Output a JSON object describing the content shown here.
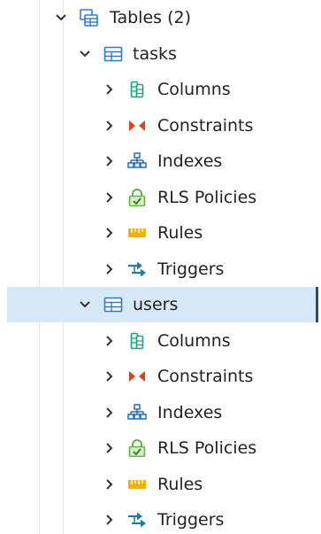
{
  "colors": {
    "selection_bg": "#d5e9f7",
    "selection_edge": "#2d4f6c",
    "table_icon": "#2b7bd4",
    "columns_icon": "#1aa383",
    "constraints_icon": "#d9421c",
    "indexes_icon": "#1f6ec4",
    "rls_icon": "#5bb53a",
    "rules_icon": "#f0b400",
    "triggers_icon": "#1b7f9e"
  },
  "tree": {
    "tables_group": {
      "label": "Tables (2)",
      "icon": "tables-icon",
      "expanded": true
    },
    "tables": [
      {
        "name": "tasks",
        "icon": "table-icon",
        "expanded": true,
        "selected": false,
        "children": [
          {
            "label": "Columns",
            "icon": "columns-icon"
          },
          {
            "label": "Constraints",
            "icon": "constraints-icon"
          },
          {
            "label": "Indexes",
            "icon": "indexes-icon"
          },
          {
            "label": "RLS Policies",
            "icon": "rls-policies-icon"
          },
          {
            "label": "Rules",
            "icon": "rules-icon"
          },
          {
            "label": "Triggers",
            "icon": "triggers-icon"
          }
        ]
      },
      {
        "name": "users",
        "icon": "table-icon",
        "expanded": true,
        "selected": true,
        "children": [
          {
            "label": "Columns",
            "icon": "columns-icon"
          },
          {
            "label": "Constraints",
            "icon": "constraints-icon"
          },
          {
            "label": "Indexes",
            "icon": "indexes-icon"
          },
          {
            "label": "RLS Policies",
            "icon": "rls-policies-icon"
          },
          {
            "label": "Rules",
            "icon": "rules-icon"
          },
          {
            "label": "Triggers",
            "icon": "triggers-icon"
          }
        ]
      }
    ]
  }
}
